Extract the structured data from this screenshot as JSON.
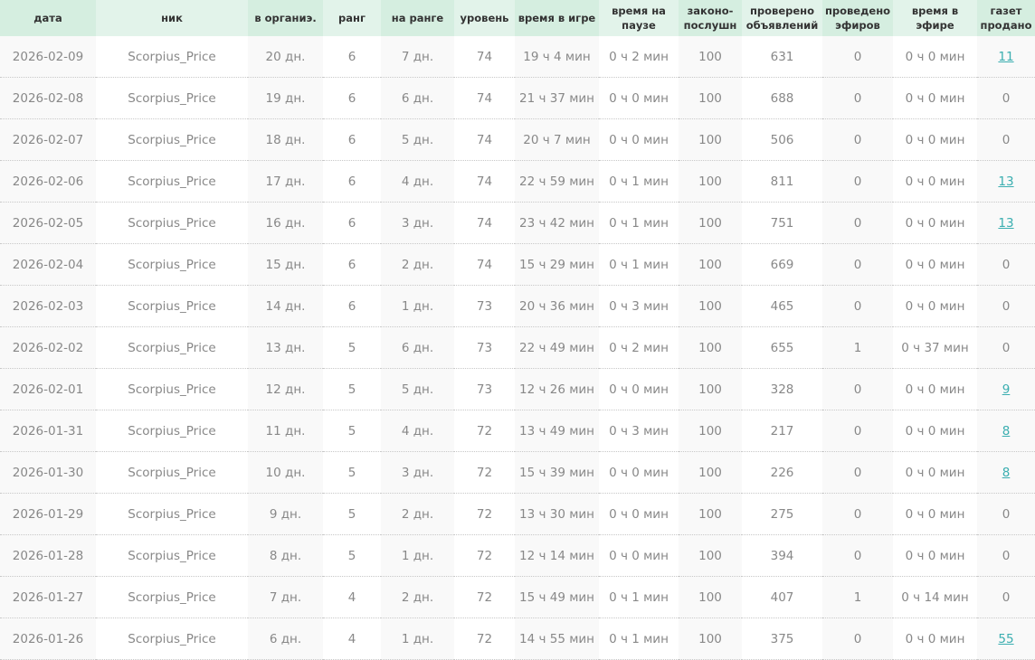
{
  "headers": [
    "дата",
    "ник",
    "в органиэ.",
    "ранг",
    "на ранге",
    "уровень",
    "время в игре",
    "время на паузе",
    "законо-послушн",
    "проверено объявлений",
    "проведено эфиров",
    "время в эфире",
    "газет продано"
  ],
  "colors": {
    "link": "#3aaeb0",
    "header_a": "#d5eee0",
    "header_b": "#e2f3ea"
  },
  "rows": [
    [
      "2026-02-09",
      "Scorpius_Price",
      "20 дн.",
      "6",
      "7 дн.",
      "74",
      "19 ч 4 мин",
      "0 ч 2 мин",
      "100",
      "631",
      "0",
      "0 ч 0 мин",
      "11"
    ],
    [
      "2026-02-08",
      "Scorpius_Price",
      "19 дн.",
      "6",
      "6 дн.",
      "74",
      "21 ч 37 мин",
      "0 ч 0 мин",
      "100",
      "688",
      "0",
      "0 ч 0 мин",
      "0"
    ],
    [
      "2026-02-07",
      "Scorpius_Price",
      "18 дн.",
      "6",
      "5 дн.",
      "74",
      "20 ч 7 мин",
      "0 ч 0 мин",
      "100",
      "506",
      "0",
      "0 ч 0 мин",
      "0"
    ],
    [
      "2026-02-06",
      "Scorpius_Price",
      "17 дн.",
      "6",
      "4 дн.",
      "74",
      "22 ч 59 мин",
      "0 ч 1 мин",
      "100",
      "811",
      "0",
      "0 ч 0 мин",
      "13"
    ],
    [
      "2026-02-05",
      "Scorpius_Price",
      "16 дн.",
      "6",
      "3 дн.",
      "74",
      "23 ч 42 мин",
      "0 ч 1 мин",
      "100",
      "751",
      "0",
      "0 ч 0 мин",
      "13"
    ],
    [
      "2026-02-04",
      "Scorpius_Price",
      "15 дн.",
      "6",
      "2 дн.",
      "74",
      "15 ч 29 мин",
      "0 ч 1 мин",
      "100",
      "669",
      "0",
      "0 ч 0 мин",
      "0"
    ],
    [
      "2026-02-03",
      "Scorpius_Price",
      "14 дн.",
      "6",
      "1 дн.",
      "73",
      "20 ч 36 мин",
      "0 ч 3 мин",
      "100",
      "465",
      "0",
      "0 ч 0 мин",
      "0"
    ],
    [
      "2026-02-02",
      "Scorpius_Price",
      "13 дн.",
      "5",
      "6 дн.",
      "73",
      "22 ч 49 мин",
      "0 ч 2 мин",
      "100",
      "655",
      "1",
      "0 ч 37 мин",
      "0"
    ],
    [
      "2026-02-01",
      "Scorpius_Price",
      "12 дн.",
      "5",
      "5 дн.",
      "73",
      "12 ч 26 мин",
      "0 ч 0 мин",
      "100",
      "328",
      "0",
      "0 ч 0 мин",
      "9"
    ],
    [
      "2026-01-31",
      "Scorpius_Price",
      "11 дн.",
      "5",
      "4 дн.",
      "72",
      "13 ч 49 мин",
      "0 ч 3 мин",
      "100",
      "217",
      "0",
      "0 ч 0 мин",
      "8"
    ],
    [
      "2026-01-30",
      "Scorpius_Price",
      "10 дн.",
      "5",
      "3 дн.",
      "72",
      "15 ч 39 мин",
      "0 ч 0 мин",
      "100",
      "226",
      "0",
      "0 ч 0 мин",
      "8"
    ],
    [
      "2026-01-29",
      "Scorpius_Price",
      "9 дн.",
      "5",
      "2 дн.",
      "72",
      "13 ч 30 мин",
      "0 ч 0 мин",
      "100",
      "275",
      "0",
      "0 ч 0 мин",
      "0"
    ],
    [
      "2026-01-28",
      "Scorpius_Price",
      "8 дн.",
      "5",
      "1 дн.",
      "72",
      "12 ч 14 мин",
      "0 ч 0 мин",
      "100",
      "394",
      "0",
      "0 ч 0 мин",
      "0"
    ],
    [
      "2026-01-27",
      "Scorpius_Price",
      "7 дн.",
      "4",
      "2 дн.",
      "72",
      "15 ч 49 мин",
      "0 ч 1 мин",
      "100",
      "407",
      "1",
      "0 ч 14 мин",
      "0"
    ],
    [
      "2026-01-26",
      "Scorpius_Price",
      "6 дн.",
      "4",
      "1 дн.",
      "72",
      "14 ч 55 мин",
      "0 ч 1 мин",
      "100",
      "375",
      "0",
      "0 ч 0 мин",
      "55"
    ]
  ]
}
